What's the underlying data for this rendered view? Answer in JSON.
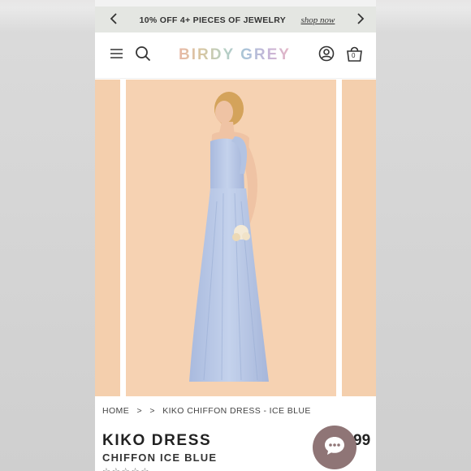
{
  "promo": {
    "text": "10% OFF 4+ PIECES OF JEWELRY",
    "link": "shop now"
  },
  "header": {
    "logo": "BIRDY GREY",
    "cart_count": "0"
  },
  "breadcrumb": {
    "home": "HOME",
    "sep1": ">",
    "sep2": ">",
    "current": "KIKO CHIFFON DRESS - ICE BLUE"
  },
  "product": {
    "name": "KIKO DRESS",
    "variant": "CHIFFON ICE BLUE",
    "price_fragment": "99"
  },
  "colors": {
    "background_peach": "#f6d2b2",
    "dress_blue": "#bccbe7",
    "chat_bubble": "#8f7576"
  },
  "icons": [
    "chevron-left-icon",
    "chevron-right-icon",
    "menu-icon",
    "search-icon",
    "account-icon",
    "cart-icon",
    "chat-icon",
    "star-icon"
  ]
}
